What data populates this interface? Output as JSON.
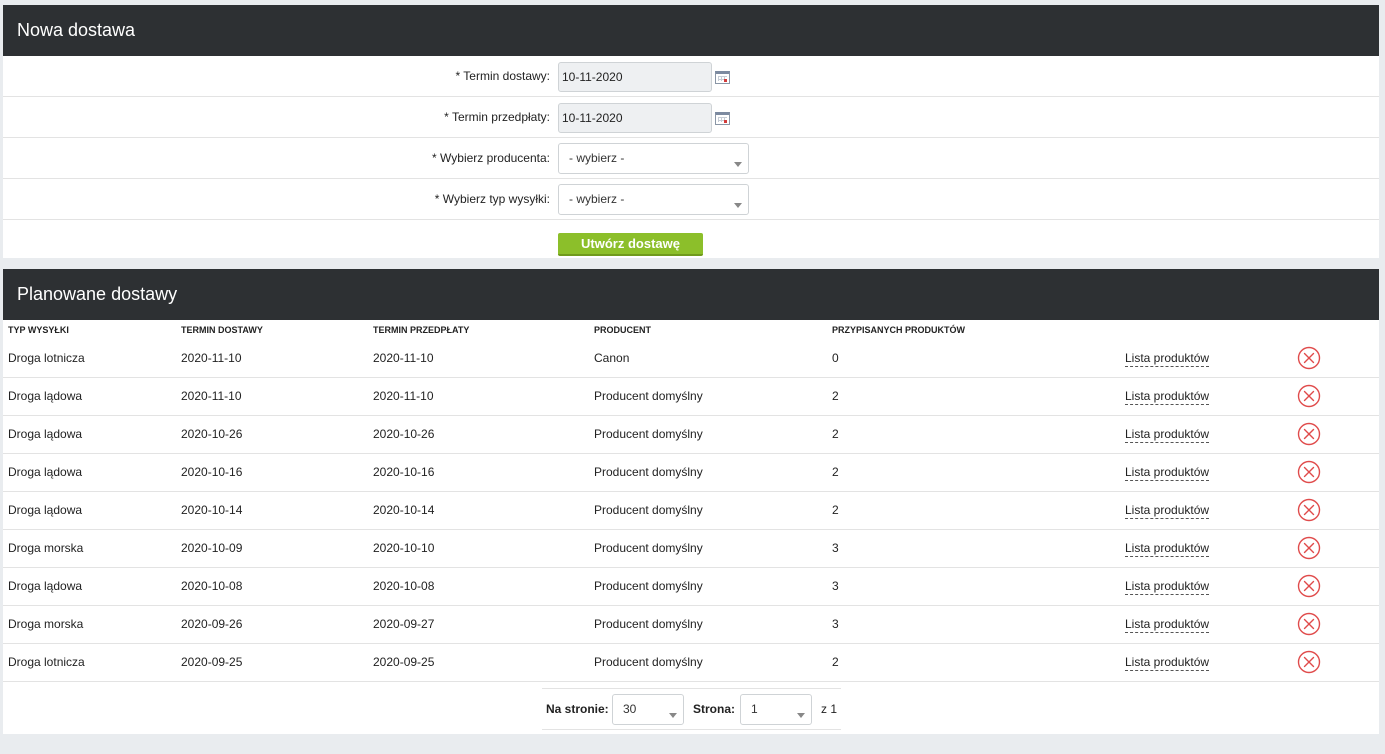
{
  "new_delivery": {
    "title": "Nowa dostawa",
    "delivery_date_label": "* Termin dostawy:",
    "delivery_date_value": "10-11-2020",
    "prepayment_date_label": "* Termin przedpłaty:",
    "prepayment_date_value": "10-11-2020",
    "producer_label": "* Wybierz producenta:",
    "producer_value": "- wybierz -",
    "shipping_type_label": "* Wybierz typ wysyłki:",
    "shipping_type_value": "- wybierz -",
    "create_button": "Utwórz dostawę"
  },
  "planned": {
    "title": "Planowane dostawy",
    "columns": [
      "TYP WYSYŁKI",
      "TERMIN DOSTAWY",
      "TERMIN PRZEDPŁATY",
      "PRODUCENT",
      "PRZYPISANYCH PRODUKTÓW"
    ],
    "link_label": "Lista produktów",
    "rows": [
      {
        "type": "Droga lotnicza",
        "delivery": "2020-11-10",
        "prepayment": "2020-11-10",
        "producer": "Canon",
        "count": "0"
      },
      {
        "type": "Droga lądowa",
        "delivery": "2020-11-10",
        "prepayment": "2020-11-10",
        "producer": "Producent domyślny",
        "count": "2"
      },
      {
        "type": "Droga lądowa",
        "delivery": "2020-10-26",
        "prepayment": "2020-10-26",
        "producer": "Producent domyślny",
        "count": "2"
      },
      {
        "type": "Droga lądowa",
        "delivery": "2020-10-16",
        "prepayment": "2020-10-16",
        "producer": "Producent domyślny",
        "count": "2"
      },
      {
        "type": "Droga lądowa",
        "delivery": "2020-10-14",
        "prepayment": "2020-10-14",
        "producer": "Producent domyślny",
        "count": "2"
      },
      {
        "type": "Droga morska",
        "delivery": "2020-10-09",
        "prepayment": "2020-10-10",
        "producer": "Producent domyślny",
        "count": "3"
      },
      {
        "type": "Droga lądowa",
        "delivery": "2020-10-08",
        "prepayment": "2020-10-08",
        "producer": "Producent domyślny",
        "count": "3"
      },
      {
        "type": "Droga morska",
        "delivery": "2020-09-26",
        "prepayment": "2020-09-27",
        "producer": "Producent domyślny",
        "count": "3"
      },
      {
        "type": "Droga lotnicza",
        "delivery": "2020-09-25",
        "prepayment": "2020-09-25",
        "producer": "Producent domyślny",
        "count": "2"
      }
    ]
  },
  "pagination": {
    "per_page_label": "Na stronie:",
    "per_page_value": "30",
    "page_label": "Strona:",
    "page_value": "1",
    "of_label": "z 1"
  },
  "icons": {
    "calendar": "calendar-icon",
    "dropdown": "chevron-down-icon",
    "delete": "delete-circle-x-icon"
  },
  "colors": {
    "header_bg": "#2d3033",
    "button_green": "#8cbf2a",
    "delete_red": "#e04b4b"
  }
}
